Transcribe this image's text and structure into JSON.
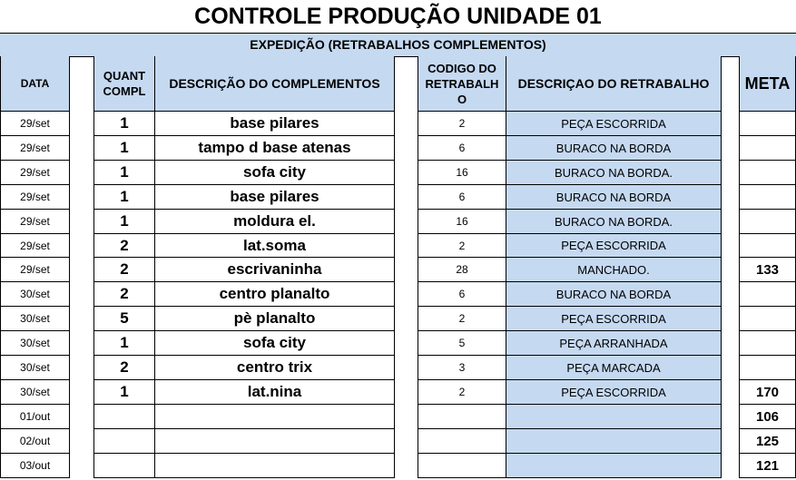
{
  "title": "CONTROLE PRODUÇÃO UNIDADE 01",
  "subtitle": "EXPEDIÇÃO (RETRABALHOS COMPLEMENTOS)",
  "headers": {
    "data": "DATA",
    "quant_line1": "QUANT",
    "quant_line2": "COMPL",
    "descricao": "DESCRIÇÃO DO COMPLEMENTOS",
    "codigo_line1": "CODIGO DO",
    "codigo_line2": "RETRABALH",
    "codigo_line3": "O",
    "retrabalho": "DESCRIÇAO DO RETRABALHO",
    "meta": "META"
  },
  "rows": [
    {
      "date": "29/set",
      "qty": "1",
      "desc": "base pilares",
      "code": "2",
      "retrabalho": "PEÇA ESCORRIDA",
      "meta": ""
    },
    {
      "date": "29/set",
      "qty": "1",
      "desc": "tampo d base atenas",
      "code": "6",
      "retrabalho": "BURACO NA BORDA",
      "meta": ""
    },
    {
      "date": "29/set",
      "qty": "1",
      "desc": "sofa city",
      "code": "16",
      "retrabalho": "BURACO NA BORDA.",
      "meta": ""
    },
    {
      "date": "29/set",
      "qty": "1",
      "desc": "base pilares",
      "code": "6",
      "retrabalho": "BURACO NA BORDA",
      "meta": ""
    },
    {
      "date": "29/set",
      "qty": "1",
      "desc": "moldura el.",
      "code": "16",
      "retrabalho": "BURACO NA BORDA.",
      "meta": ""
    },
    {
      "date": "29/set",
      "qty": "2",
      "desc": "lat.soma",
      "code": "2",
      "retrabalho": "PEÇA ESCORRIDA",
      "meta": ""
    },
    {
      "date": "29/set",
      "qty": "2",
      "desc": "escrivaninha",
      "code": "28",
      "retrabalho": "MANCHADO.",
      "meta": "133"
    },
    {
      "date": "30/set",
      "qty": "2",
      "desc": "centro planalto",
      "code": "6",
      "retrabalho": "BURACO NA BORDA",
      "meta": ""
    },
    {
      "date": "30/set",
      "qty": "5",
      "desc": "pè planalto",
      "code": "2",
      "retrabalho": "PEÇA ESCORRIDA",
      "meta": ""
    },
    {
      "date": "30/set",
      "qty": "1",
      "desc": "sofa city",
      "code": "5",
      "retrabalho": "PEÇA ARRANHADA",
      "meta": ""
    },
    {
      "date": "30/set",
      "qty": "2",
      "desc": "centro trix",
      "code": "3",
      "retrabalho": "PEÇA MARCADA",
      "meta": ""
    },
    {
      "date": "30/set",
      "qty": "1",
      "desc": "lat.nina",
      "code": "2",
      "retrabalho": "PEÇA ESCORRIDA",
      "meta": "170"
    },
    {
      "date": "01/out",
      "qty": "",
      "desc": "",
      "code": "",
      "retrabalho": "",
      "meta": "106"
    },
    {
      "date": "02/out",
      "qty": "",
      "desc": "",
      "code": "",
      "retrabalho": "",
      "meta": "125"
    },
    {
      "date": "03/out",
      "qty": "",
      "desc": "",
      "code": "",
      "retrabalho": "",
      "meta": "121"
    }
  ]
}
